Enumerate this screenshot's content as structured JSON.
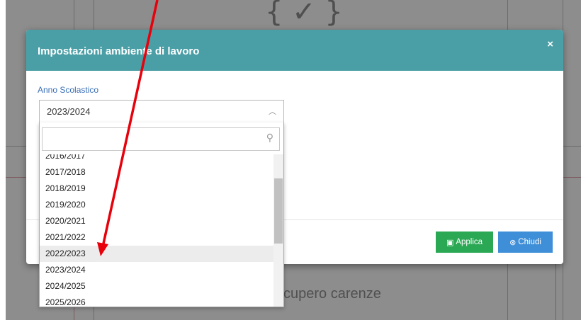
{
  "background": {
    "text": "cupero carenze"
  },
  "modal": {
    "title": "Impostazioni ambiente di lavoro",
    "close_symbol": "×",
    "field_label": "Anno Scolastico"
  },
  "select": {
    "value": "2023/2024",
    "search_placeholder": "",
    "options": [
      "2016/2017",
      "2017/2018",
      "2018/2019",
      "2019/2020",
      "2020/2021",
      "2021/2022",
      "2022/2023",
      "2023/2024",
      "2024/2025",
      "2025/2026"
    ],
    "highlighted": "2022/2023"
  },
  "buttons": {
    "apply_label": "Applica",
    "close_label": "Chiudi"
  },
  "icons": {
    "search": "search-icon",
    "chevron": "chevron-up-icon",
    "save": "save-icon",
    "close_circle": "close-circle-icon"
  },
  "colors": {
    "header": "#4a9fa6",
    "apply": "#2aa854",
    "close": "#3e8ed8",
    "label": "#3a6fb6",
    "annotation_arrow": "#e8000b"
  }
}
